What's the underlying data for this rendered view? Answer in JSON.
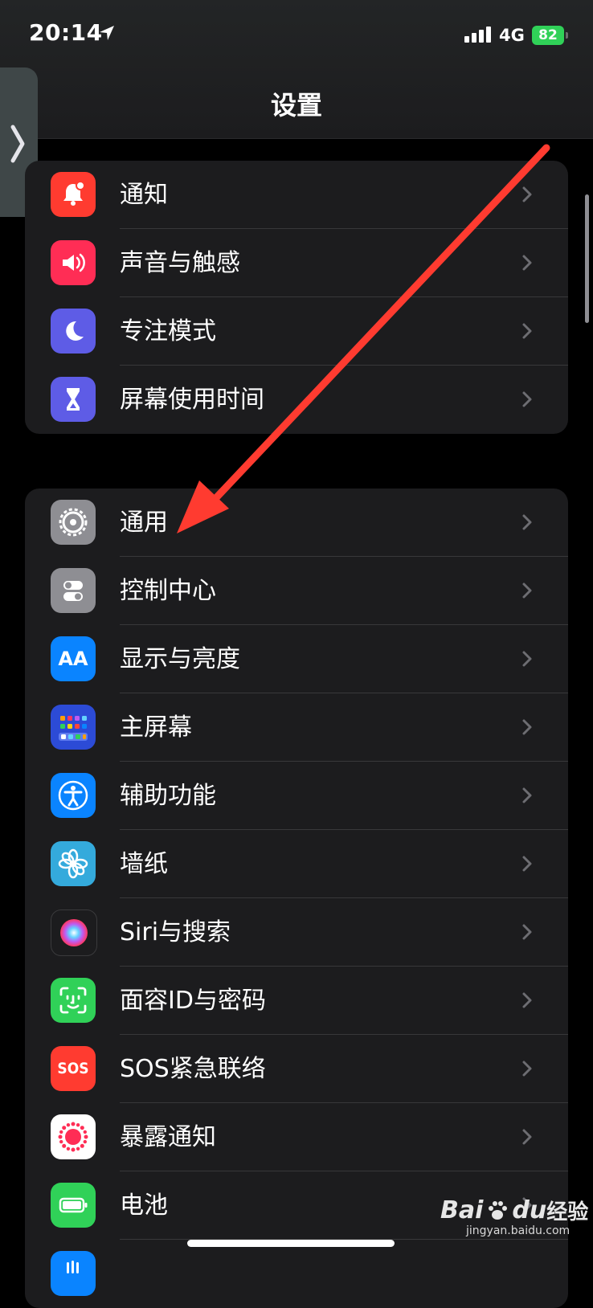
{
  "status_bar": {
    "time": "20:14",
    "network": "4G",
    "battery": "82"
  },
  "header": {
    "title": "设置"
  },
  "groups": [
    {
      "items": [
        {
          "label": "通知",
          "icon": "bell-icon",
          "color": "#ff3b30"
        },
        {
          "label": "声音与触感",
          "icon": "speaker-icon",
          "color": "#ff2d55"
        },
        {
          "label": "专注模式",
          "icon": "moon-icon",
          "color": "#5e5ce6"
        },
        {
          "label": "屏幕使用时间",
          "icon": "hourglass-icon",
          "color": "#5e5ce6"
        }
      ]
    },
    {
      "items": [
        {
          "label": "通用",
          "icon": "gear-icon",
          "color": "#8e8e93"
        },
        {
          "label": "控制中心",
          "icon": "toggles-icon",
          "color": "#8e8e93"
        },
        {
          "label": "显示与亮度",
          "icon": "text-size-icon",
          "icon_text": "AA",
          "color": "#0a84ff"
        },
        {
          "label": "主屏幕",
          "icon": "home-grid-icon",
          "color": "#2c4bd6"
        },
        {
          "label": "辅助功能",
          "icon": "accessibility-icon",
          "color": "#0a84ff"
        },
        {
          "label": "墙纸",
          "icon": "flower-icon",
          "color": "#34aadc"
        },
        {
          "label": "Siri与搜索",
          "icon": "siri-icon",
          "color": "#1c1c1e"
        },
        {
          "label": "面容ID与密码",
          "icon": "face-id-icon",
          "color": "#30d158"
        },
        {
          "label": "SOS紧急联络",
          "icon": "sos-icon",
          "icon_text": "SOS",
          "color": "#ff3b30"
        },
        {
          "label": "暴露通知",
          "icon": "exposure-icon",
          "color": "#ffffff"
        },
        {
          "label": "电池",
          "icon": "battery-icon",
          "color": "#30d158"
        }
      ]
    }
  ],
  "watermark": {
    "brand": "Bai",
    "brand_suffix": "du",
    "jingyan": "经验",
    "url": "jingyan.baidu.com"
  }
}
